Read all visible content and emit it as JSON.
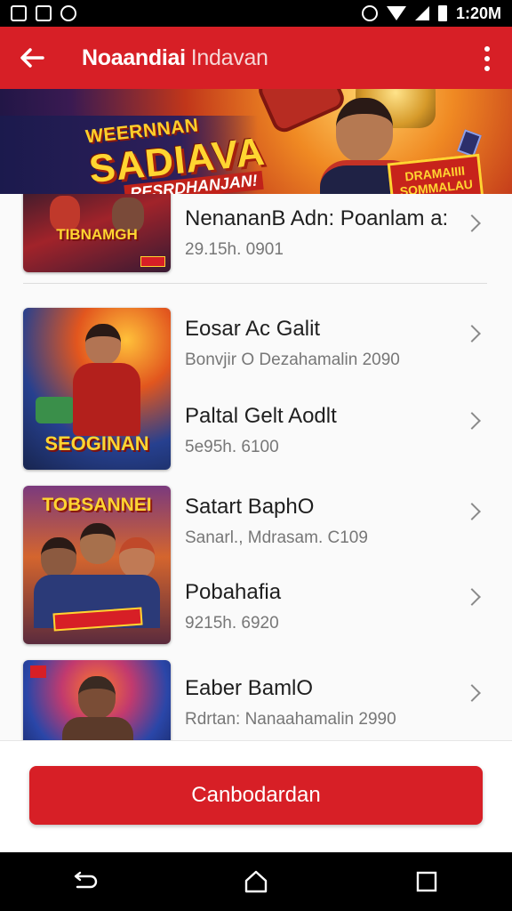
{
  "status_bar": {
    "time": "1:20M"
  },
  "app_bar": {
    "title": "Noaandiai",
    "subtitle": "Indavan"
  },
  "banner": {
    "line1": "WEERNNAN",
    "line2": "SADIAVA",
    "line3": "RESRDHANJAN!",
    "badge_line1": "DRAMAIIII",
    "badge_line2": "SOMMALAU"
  },
  "items": [
    {
      "thumb_label": "TIBNAMGH",
      "title": "NenananB Adn: Poanlam a:",
      "subtitle": "29.15h. 0901"
    },
    {
      "thumb_label": "SEOGINAN",
      "title": "Eosar Ac Galit",
      "subtitle": "Bonvjir O Dezahamalin 2090"
    },
    {
      "thumb_label": "",
      "title": "Paltal Gelt Aodlt",
      "subtitle": "5e95h. 6100"
    },
    {
      "thumb_label": "TOBSANNEI",
      "title": "Satart BaphO",
      "subtitle": "Sanarl., Mdrasam. C109"
    },
    {
      "thumb_label": "",
      "title": "Pobahafia",
      "subtitle": "9215h. 6920"
    },
    {
      "thumb_label": "",
      "title": "Eaber BamlO",
      "subtitle": "Rdrtan: Nanaahamalin 2990"
    }
  ],
  "cta": {
    "label": "Canbodardan"
  },
  "colors": {
    "brand_red": "#d71f26",
    "background": "#fafafa"
  }
}
